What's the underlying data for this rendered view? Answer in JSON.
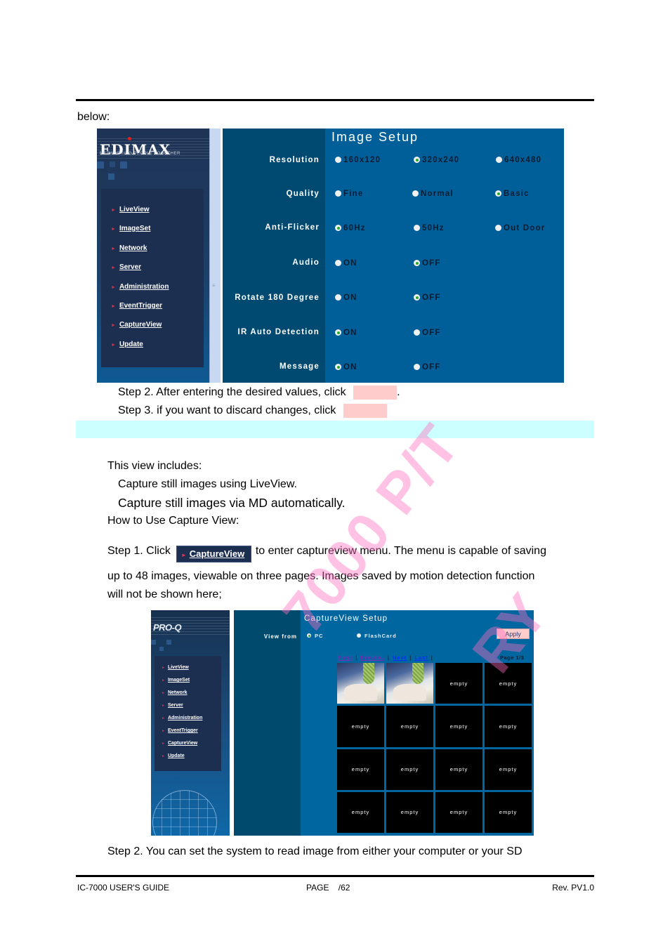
{
  "page": {
    "intro_text": "below:",
    "step2_text": "Step 2. After entering the desired values, click",
    "step2_suffix": ".",
    "step3_text": "Step 3. if you want to discard changes, click",
    "includes_heading": "This view includes:",
    "includes_items": [
      "Capture still images using LiveView.",
      "Capture still images via MD automatically."
    ],
    "how_to_heading": "How to Use Capture View:",
    "capture_step1_prefix": "Step 1. Click",
    "capture_step1_suffix": "to enter captureview menu. The menu is capable of saving",
    "capture_step1_line2": "up to 48 images, viewable on three pages. Images saved by motion detection function",
    "capture_step1_line3": "will not be shown here;",
    "capture_step2_text": "Step 2. You can set the system to read image from either your computer or your SD",
    "inline_button": {
      "icon": "arrow-right-icon",
      "label": "CaptureView"
    },
    "watermark": [
      "7000 P/T",
      "RY"
    ],
    "colors": {
      "highlight_band": "#ccffff",
      "button_placeholder": "#ffcccc",
      "watermark": "#ff6ebe"
    }
  },
  "footer": {
    "left": "IC-7000 USER'S GUIDE",
    "center": "PAGE    /62",
    "right": "Rev. PV1.0"
  },
  "image_setup": {
    "brand": "EDIMAX",
    "tagline": "NETWORKING PEOPLE TOGETHER",
    "title": "Image Setup",
    "menu": [
      "LiveView",
      "ImageSet",
      "Network",
      "Server",
      "Administration",
      "EventTrigger",
      "CaptureView",
      "Update"
    ],
    "settings": [
      {
        "label": "Resolution",
        "options": [
          "160x120",
          "320x240",
          "640x480"
        ],
        "selected": "320x240"
      },
      {
        "label": "Quality",
        "options": [
          "Fine",
          "Normal",
          "Basic"
        ],
        "selected": "Basic"
      },
      {
        "label": "Anti-Flicker",
        "options": [
          "60Hz",
          "50Hz",
          "Out Door"
        ],
        "selected": "60Hz"
      },
      {
        "label": "Audio",
        "options": [
          "ON",
          "OFF"
        ],
        "selected": "OFF"
      },
      {
        "label": "Rotate 180 Degree",
        "options": [
          "ON",
          "OFF"
        ],
        "selected": "OFF"
      },
      {
        "label": "IR Auto Detection",
        "options": [
          "ON",
          "OFF"
        ],
        "selected": "ON"
      },
      {
        "label": "Message",
        "options": [
          "ON",
          "OFF"
        ],
        "selected": "ON"
      }
    ],
    "colors": {
      "panel": "#005f99",
      "label_column": "#004a72",
      "sidebar_menu": "#1d2f50",
      "selected_radio": "#2aa830"
    }
  },
  "capture_view": {
    "brand": "PRO-Q",
    "title": "CaptureView Setup",
    "menu": [
      "LiveView",
      "ImageSet",
      "Network",
      "Server",
      "Administration",
      "EventTrigger",
      "CaptureView",
      "Update"
    ],
    "view_from_label": "View from",
    "view_from_options": [
      "PC",
      "FlashCard"
    ],
    "view_from_selected": "PC",
    "apply_label": "Apply",
    "pager": {
      "first": "First",
      "previous": "Previou",
      "next": "Next",
      "last": "Last",
      "separator": "|",
      "page_label": "Page 1/3"
    },
    "thumbnails": [
      "image",
      "image",
      "empty",
      "empty",
      "empty",
      "empty",
      "empty",
      "empty",
      "empty",
      "empty",
      "empty",
      "empty",
      "empty",
      "empty",
      "empty",
      "empty"
    ],
    "empty_label": "empty",
    "colors": {
      "panel": "#0066a0",
      "thumb_bg": "#000000",
      "visited_link": "#7a2ab8",
      "link": "#0a2cff"
    }
  }
}
